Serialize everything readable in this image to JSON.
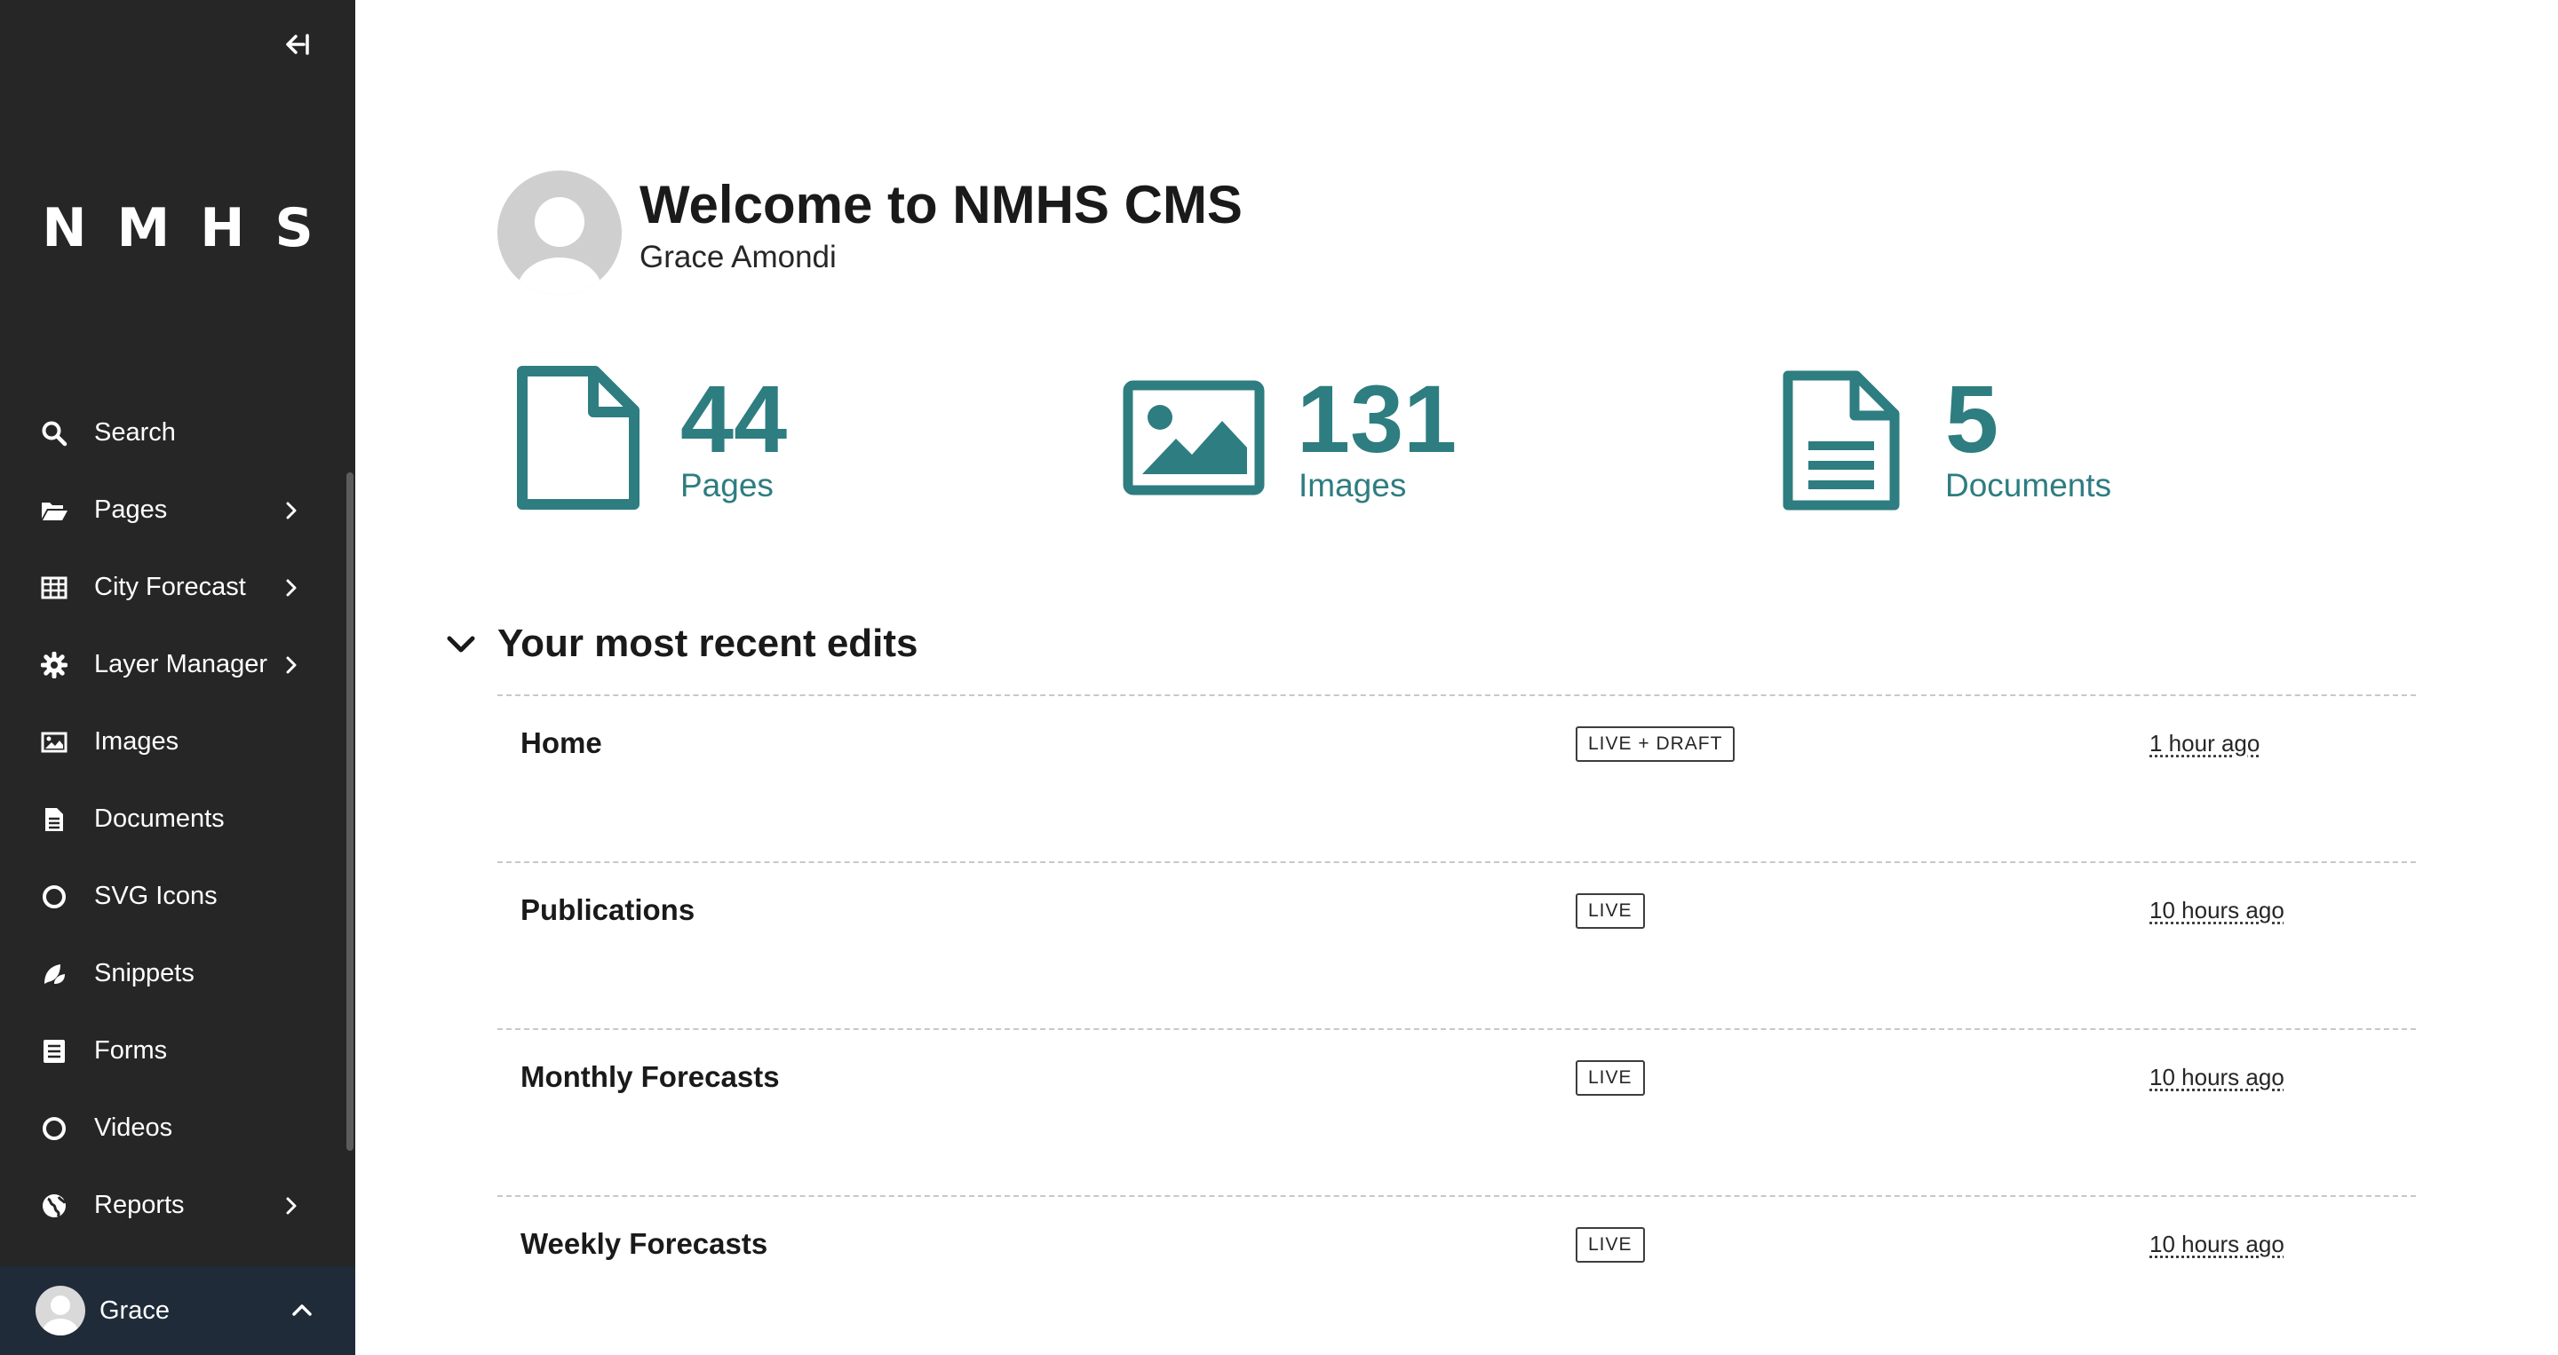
{
  "sidebar": {
    "logo": "NMHS",
    "items": [
      {
        "label": "Search",
        "icon": "search-icon",
        "has_submenu": false
      },
      {
        "label": "Pages",
        "icon": "folder-open-icon",
        "has_submenu": true
      },
      {
        "label": "City Forecast",
        "icon": "table-icon",
        "has_submenu": true
      },
      {
        "label": "Layer Manager",
        "icon": "gear-icon",
        "has_submenu": true
      },
      {
        "label": "Images",
        "icon": "image-icon",
        "has_submenu": false
      },
      {
        "label": "Documents",
        "icon": "document-icon",
        "has_submenu": false
      },
      {
        "label": "SVG Icons",
        "icon": "circle-icon",
        "has_submenu": false
      },
      {
        "label": "Snippets",
        "icon": "snippet-icon",
        "has_submenu": false
      },
      {
        "label": "Forms",
        "icon": "form-icon",
        "has_submenu": false
      },
      {
        "label": "Videos",
        "icon": "circle-icon",
        "has_submenu": false
      },
      {
        "label": "Reports",
        "icon": "globe-icon",
        "has_submenu": true
      }
    ],
    "account": {
      "name": "Grace"
    }
  },
  "welcome": {
    "title": "Welcome to NMHS CMS",
    "user_name": "Grace Amondi"
  },
  "stats": [
    {
      "number": "44",
      "label": "Pages",
      "icon": "page-icon"
    },
    {
      "number": "131",
      "label": "Images",
      "icon": "image-icon"
    },
    {
      "number": "5",
      "label": "Documents",
      "icon": "document-icon"
    }
  ],
  "recent_edits": {
    "title": "Your most recent edits",
    "rows": [
      {
        "title": "Home",
        "status": "LIVE + DRAFT",
        "time": "1 hour ago"
      },
      {
        "title": "Publications",
        "status": "LIVE",
        "time": "10 hours ago"
      },
      {
        "title": "Monthly Forecasts",
        "status": "LIVE",
        "time": "10 hours ago"
      },
      {
        "title": "Weekly Forecasts",
        "status": "LIVE",
        "time": "10 hours ago"
      }
    ]
  },
  "colors": {
    "sidebar_bg": "#262626",
    "accent": "#2e7d80",
    "account_bg": "#1f2b38"
  }
}
